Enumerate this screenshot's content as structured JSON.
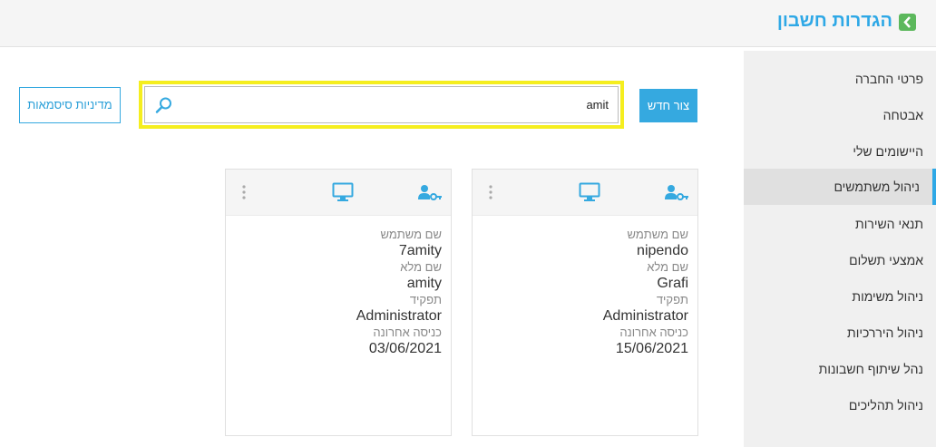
{
  "header": {
    "title": "הגדרות חשבון"
  },
  "sidebar": {
    "items": [
      {
        "label": "פרטי החברה"
      },
      {
        "label": "אבטחה"
      },
      {
        "label": "היישומים שלי"
      },
      {
        "label": "ניהול משתמשים",
        "active": true
      },
      {
        "label": "תנאי השירות"
      },
      {
        "label": "אמצעי תשלום"
      },
      {
        "label": "ניהול משימות"
      },
      {
        "label": "ניהול היררכיות"
      },
      {
        "label": "נהל שיתוף חשבונות"
      },
      {
        "label": "ניהול תהליכים"
      }
    ]
  },
  "toolbar": {
    "new_label": "צור חדש",
    "policy_label": "מדיניות סיסמאות",
    "search_value": "amit"
  },
  "labels": {
    "username": "שם משתמש",
    "fullname": "שם מלא",
    "role": "תפקיד",
    "last_login": "כניסה אחרונה"
  },
  "users": [
    {
      "username": "nipendo",
      "fullname": "Grafi",
      "role": "Administrator",
      "last_login": "15/06/2021"
    },
    {
      "username": "7amity",
      "fullname": "amity",
      "role": "Administrator",
      "last_login": "03/06/2021"
    }
  ],
  "colors": {
    "accent": "#35a9e0",
    "highlight": "#f5ee1f",
    "back_button": "#5cb85c"
  }
}
